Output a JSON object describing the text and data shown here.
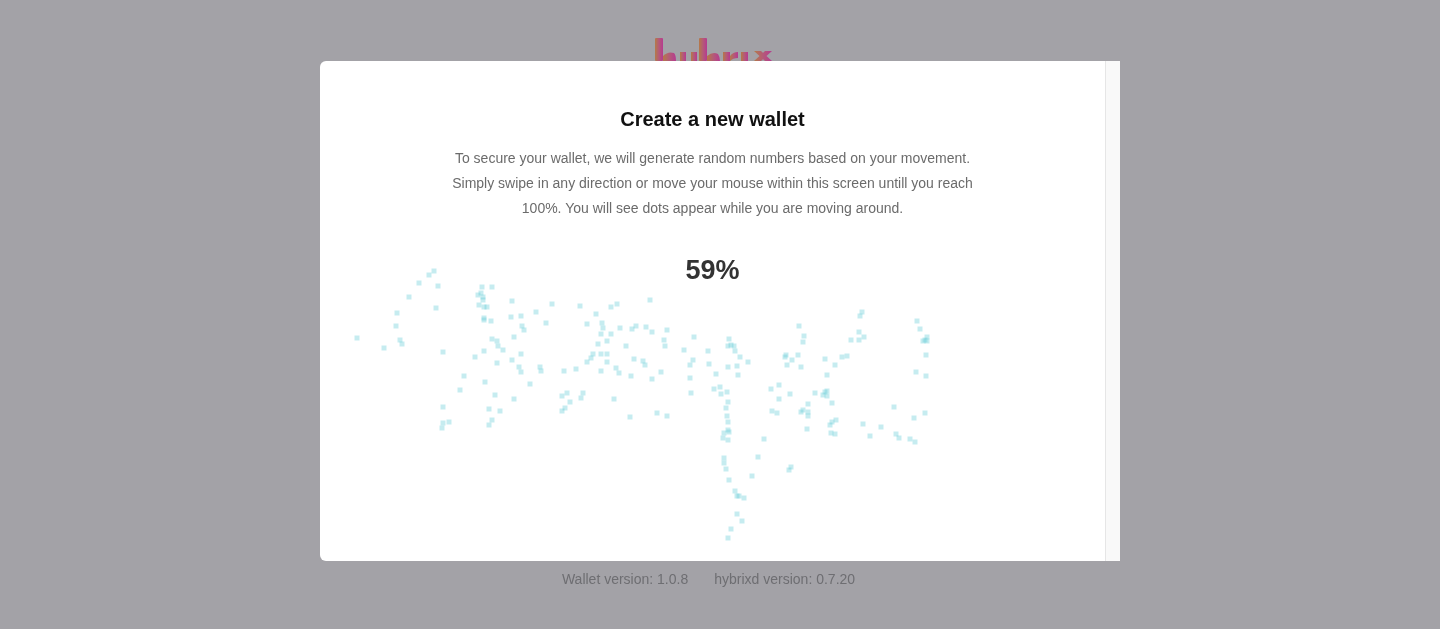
{
  "dialog": {
    "title": "Create a new wallet",
    "description": "To secure your wallet, we will generate random numbers based on your movement. Simply swipe in any direction or move your mouse within this screen untill you reach 100%. You will see dots appear while you are moving around.",
    "progress": "59%"
  },
  "footer": {
    "versions": [
      "Wallet version: 1.0.8",
      "hybrixd version: 0.7.20"
    ]
  }
}
